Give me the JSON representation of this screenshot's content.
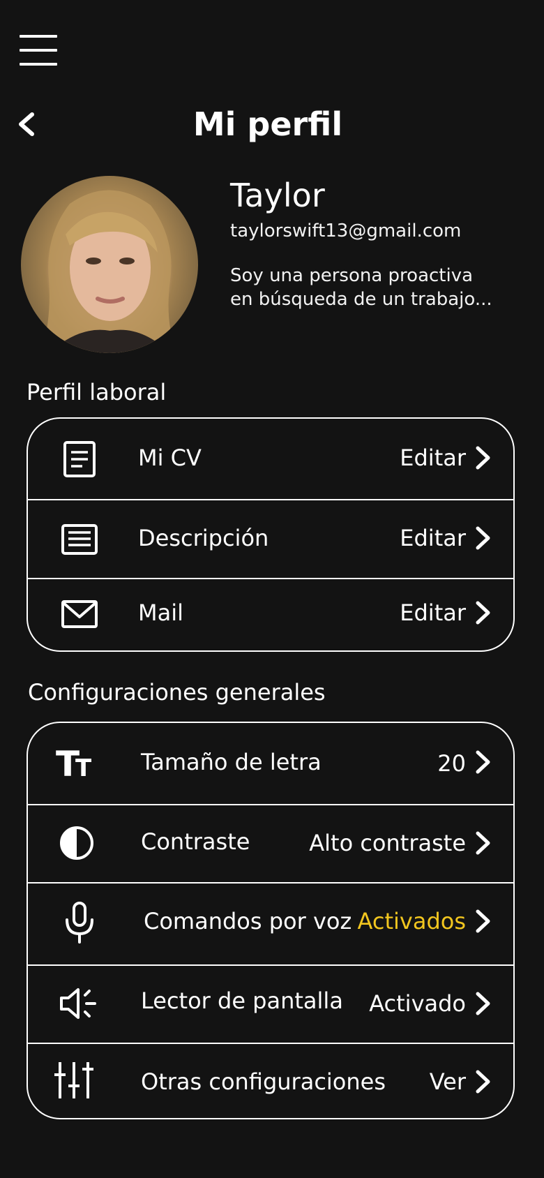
{
  "header": {
    "menu_icon": "hamburger-menu-icon",
    "back_icon": "chevron-left-icon",
    "title": "Mi perfil"
  },
  "profile": {
    "avatar": "profile-photo",
    "name": "Taylor",
    "email": "taylorswift13@gmail.com",
    "bio_line1": "Soy una persona proactiva",
    "bio_line2": "en búsqueda de un trabajo..."
  },
  "work_profile": {
    "title": "Perfil laboral",
    "items": [
      {
        "icon": "document-icon",
        "label": "Mi CV",
        "value": "Editar"
      },
      {
        "icon": "description-icon",
        "label": "Descripción",
        "value": "Editar"
      },
      {
        "icon": "mail-icon",
        "label": "Mail",
        "value": "Editar"
      }
    ]
  },
  "general_settings": {
    "title": "Configuraciones generales",
    "items": [
      {
        "icon": "text-size-icon",
        "label": "Tamaño de letra",
        "value": "20"
      },
      {
        "icon": "contrast-icon",
        "label": "Contraste",
        "value": "Alto contraste"
      },
      {
        "icon": "microphone-icon",
        "label": "Comandos por voz",
        "value": "Activados"
      },
      {
        "icon": "speaker-icon",
        "label": "Lector de pantalla",
        "value": "Activado"
      },
      {
        "icon": "sliders-icon",
        "label": "Otras configuraciones",
        "value": "Ver"
      }
    ]
  },
  "colors": {
    "background": "#131313",
    "text": "#ffffff",
    "accent": "#f2c61f"
  }
}
